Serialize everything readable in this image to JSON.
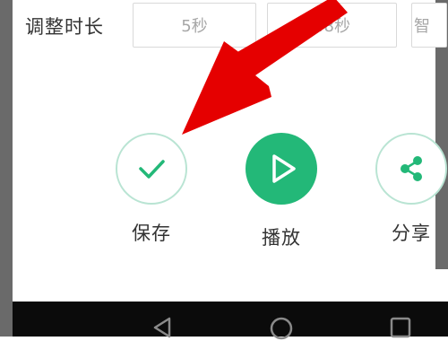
{
  "duration": {
    "label": "调整时长",
    "options": [
      "5秒",
      "48秒",
      "智"
    ]
  },
  "actions": {
    "save": {
      "label": "保存",
      "icon": "check-icon"
    },
    "play": {
      "label": "播放",
      "icon": "play-icon"
    },
    "share": {
      "label": "分享",
      "icon": "share-icon"
    }
  },
  "colors": {
    "accent": "#23b878",
    "outline": "#b9e4d3",
    "annotation_arrow": "#e50000"
  },
  "navbar": {
    "icons": [
      "back-icon",
      "home-icon",
      "recents-icon"
    ]
  }
}
